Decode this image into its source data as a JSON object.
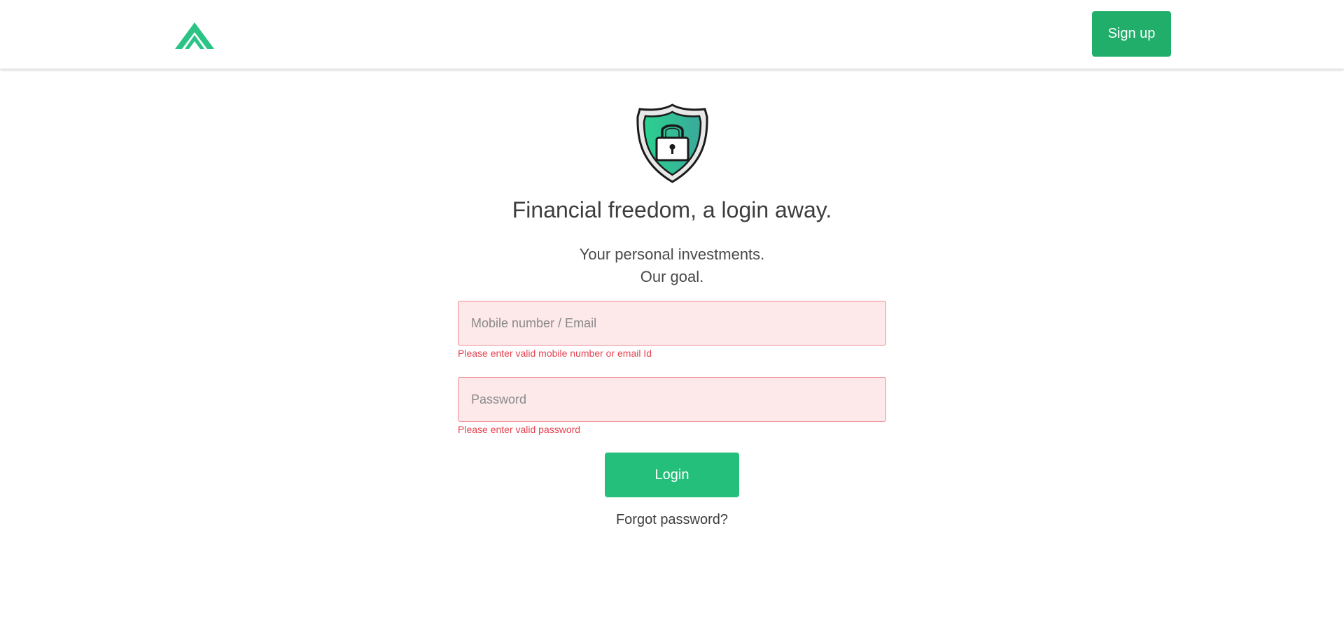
{
  "header": {
    "logo_icon": "chevron-up-logo-icon",
    "signup_label": "Sign up"
  },
  "hero": {
    "icon": "shield-lock-icon",
    "title": "Financial freedom, a login away.",
    "subtitle_line1": "Your personal investments.",
    "subtitle_line2": "Our goal."
  },
  "form": {
    "identifier": {
      "placeholder": "Mobile number / Email",
      "value": "",
      "error": "Please enter valid mobile number or email Id"
    },
    "password": {
      "placeholder": "Password",
      "value": "",
      "error": "Please enter valid password"
    },
    "login_label": "Login",
    "forgot_label": "Forgot password?"
  },
  "colors": {
    "brand_green": "#21ad6a",
    "button_green": "#24bf7a",
    "error_red": "#e5424f",
    "error_bg": "#fde8ea"
  }
}
